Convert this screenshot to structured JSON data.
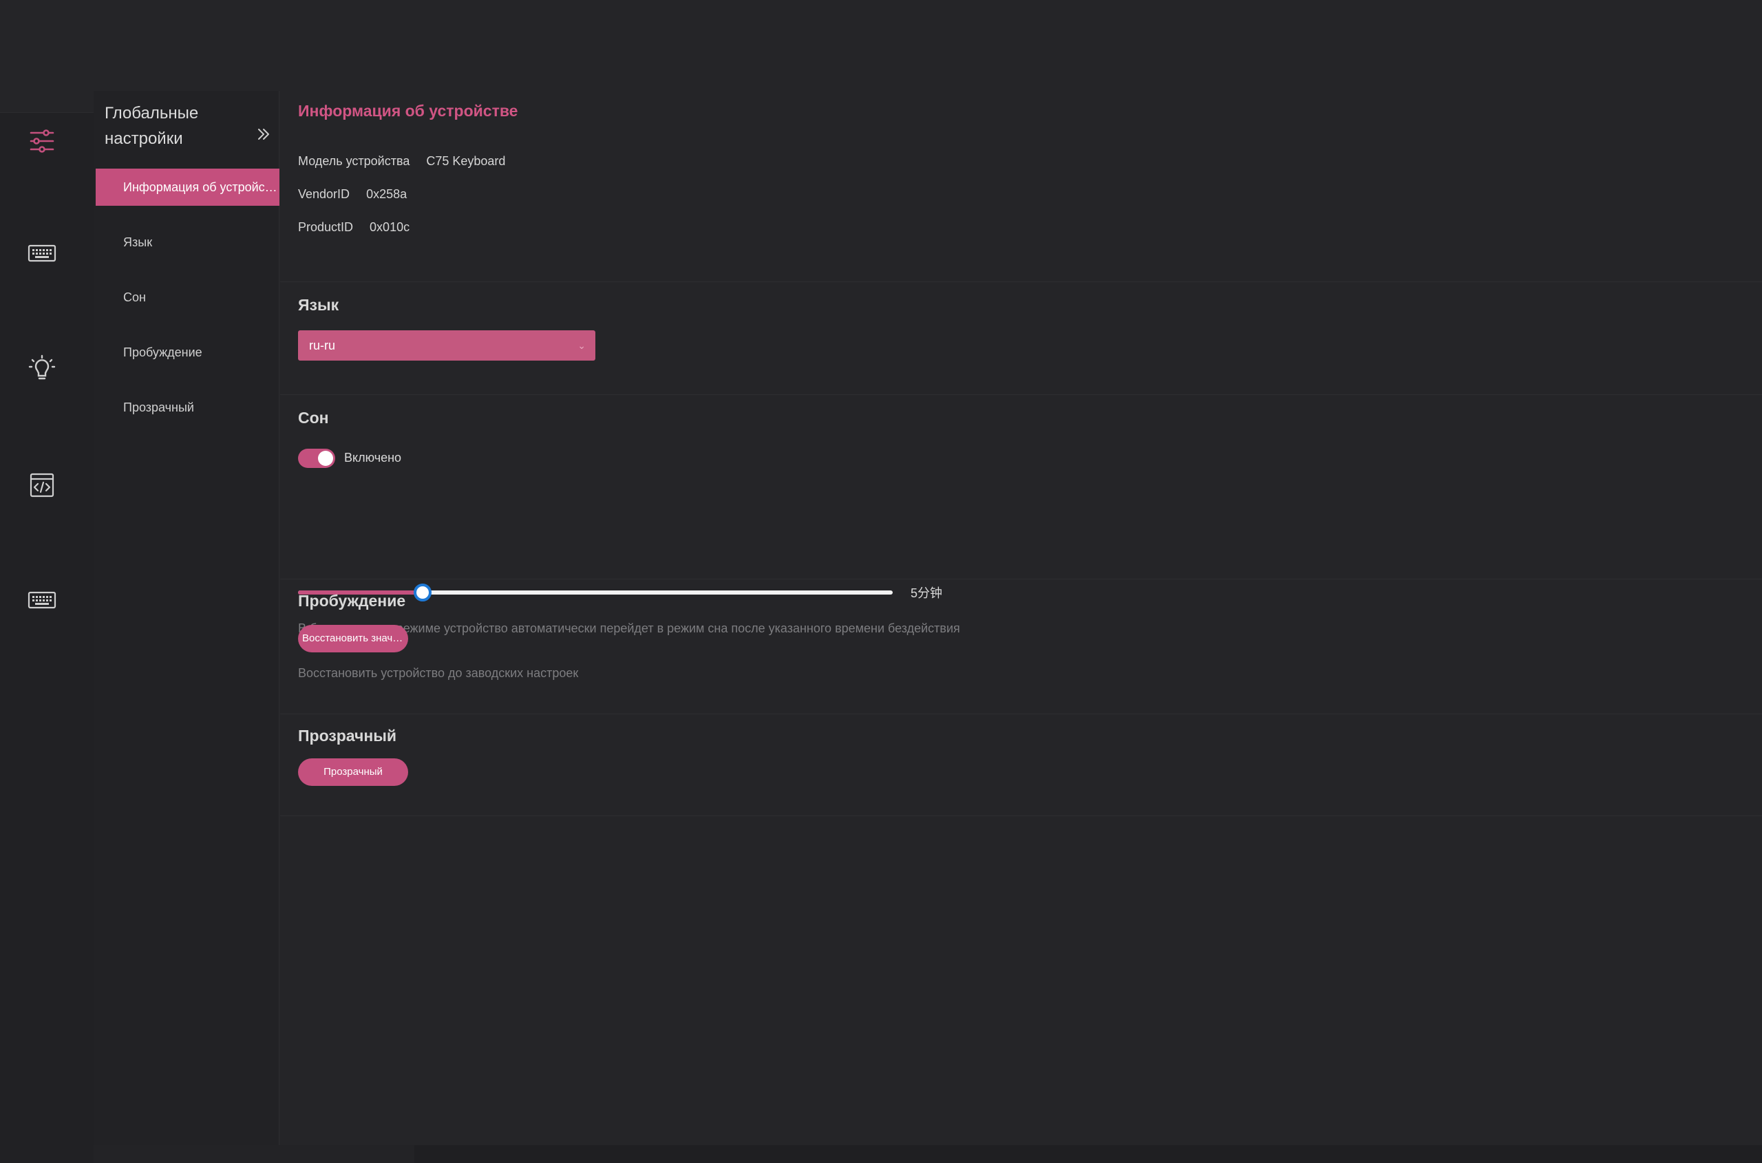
{
  "sidebar_rail": {
    "items": [
      {
        "icon": "sliders-icon",
        "active": true
      },
      {
        "icon": "keyboard-icon",
        "active": false
      },
      {
        "icon": "lightbulb-icon",
        "active": false
      },
      {
        "icon": "code-window-icon",
        "active": false
      },
      {
        "icon": "keyboard-icon",
        "active": false
      }
    ]
  },
  "subnav": {
    "title_line1": "Глобальные",
    "title_line2": "настройки",
    "collapse_icon": "double-chevron-right-icon",
    "items": [
      {
        "label": "Информация об устройстве",
        "active": true
      },
      {
        "label": "Язык",
        "active": false
      },
      {
        "label": "Сон",
        "active": false
      },
      {
        "label": "Пробуждение",
        "active": false
      },
      {
        "label": "Прозрачный",
        "active": false
      }
    ]
  },
  "device_info": {
    "title": "Информация об устройстве",
    "model_label": "Модель устройства",
    "model_value": "C75 Keyboard",
    "vendor_label": "VendorID",
    "vendor_value": "0x258a",
    "product_label": "ProductID",
    "product_value": "0x010c"
  },
  "language": {
    "title": "Язык",
    "selected": "ru-ru"
  },
  "sleep": {
    "title": "Сон",
    "toggle_label": "Включено",
    "enabled": true,
    "slider_fraction": 0.21,
    "slider_value_text": "5分钟",
    "hint": "В беспроводном режиме устройство автоматически перейдет в режим сна после указанного времени бездействия"
  },
  "wakeup": {
    "title": "Пробуждение",
    "button_label": "Восстановить значения по умолчанию",
    "hint": "Восстановить устройство до заводских настроек"
  },
  "transparent": {
    "title": "Прозрачный",
    "button_label": "Прозрачный"
  },
  "colors": {
    "accent": "#c4507e",
    "background": "#252528",
    "rail": "#212124"
  }
}
